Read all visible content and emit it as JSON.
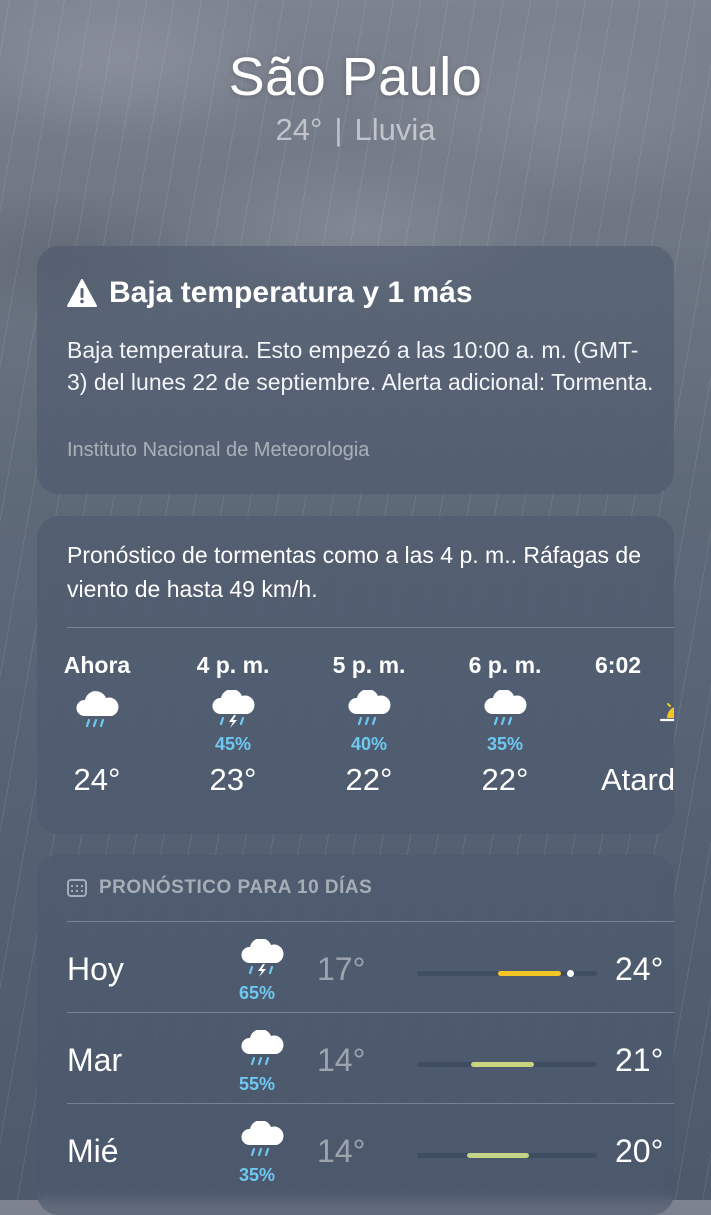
{
  "header": {
    "city": "São Paulo",
    "current_temp": "24°",
    "separator": "|",
    "condition": "Lluvia"
  },
  "alert": {
    "title": "Baja temperatura y 1 más",
    "body": "Baja temperatura. Esto empezó a las 10:00 a. m. (GMT-3) del lunes 22 de septiembre. Alerta adicional: Tormenta.",
    "source": "Instituto Nacional de Meteorologia"
  },
  "hourly": {
    "description": "Pronóstico de tormentas como a las 4 p. m.. Ráfagas de viento de hasta 49 km/h.",
    "items": [
      {
        "time": "Ahora",
        "icon": "cloud-rain-icon",
        "pop": "",
        "temp": "24°"
      },
      {
        "time": "4 p. m.",
        "icon": "cloud-bolt-rain-icon",
        "pop": "45%",
        "temp": "23°"
      },
      {
        "time": "5 p. m.",
        "icon": "cloud-rain-icon",
        "pop": "40%",
        "temp": "22°"
      },
      {
        "time": "6 p. m.",
        "icon": "cloud-rain-icon",
        "pop": "35%",
        "temp": "22°"
      },
      {
        "time": "6:02",
        "icon": "sunset-icon",
        "pop": "",
        "temp": "Atardecer"
      }
    ]
  },
  "daily": {
    "header": "PRONÓSTICO PARA 10 DÍAS",
    "days": [
      {
        "day": "Hoy",
        "icon": "cloud-bolt-rain-icon",
        "pop": "65%",
        "low": "17°",
        "high": "24°",
        "bar_start": 0.45,
        "bar_end": 0.8,
        "bar_color": "#f3c623",
        "current_marker": 0.85
      },
      {
        "day": "Mar",
        "icon": "cloud-rain-icon",
        "pop": "55%",
        "low": "14°",
        "high": "21°",
        "bar_start": 0.3,
        "bar_end": 0.65,
        "bar_color": "#c9d57e"
      },
      {
        "day": "Mié",
        "icon": "cloud-rain-icon",
        "pop": "35%",
        "low": "14°",
        "high": "20°",
        "bar_start": 0.28,
        "bar_end": 0.62,
        "bar_color": "#c3d489"
      }
    ]
  },
  "colors": {
    "precip": "#6ec8f2",
    "sun": "#f3c623"
  }
}
